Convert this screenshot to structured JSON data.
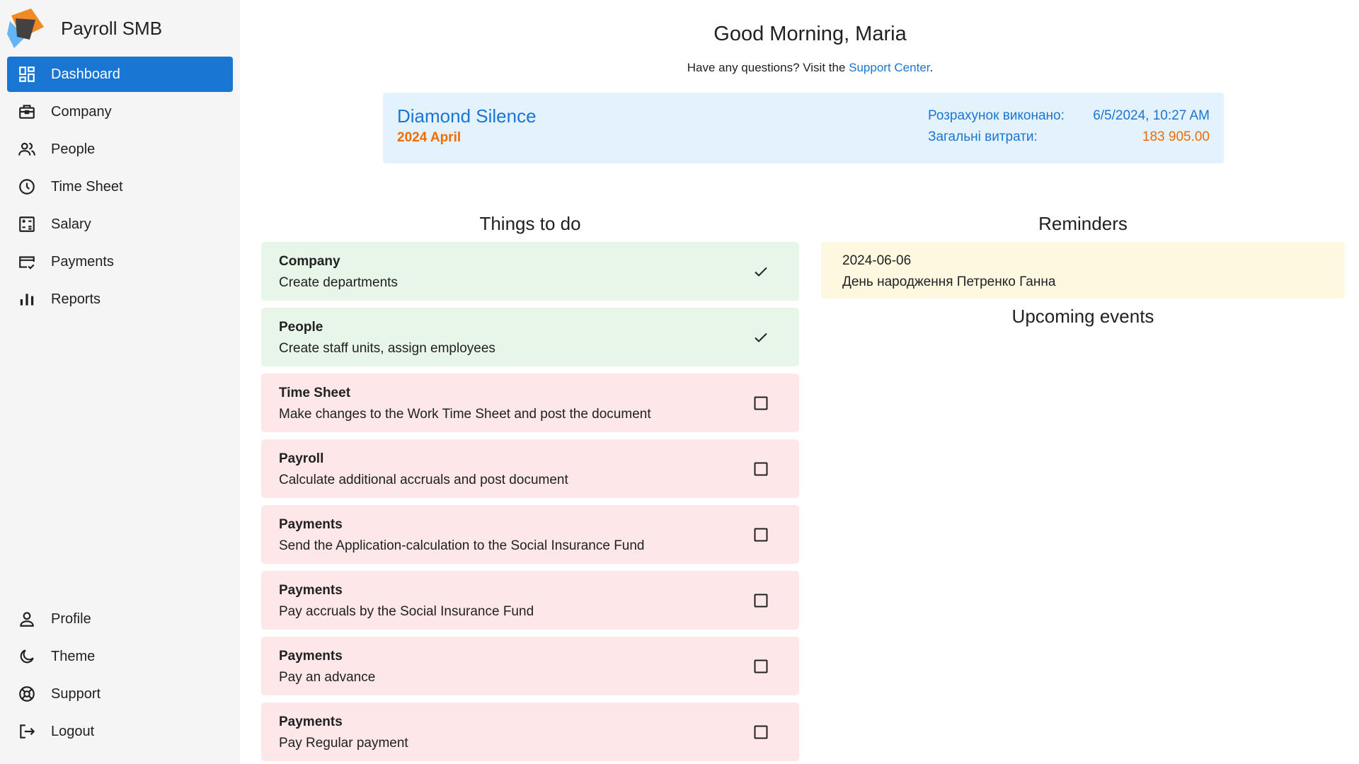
{
  "app": {
    "name": "Payroll SMB"
  },
  "sidebar": {
    "items": [
      {
        "label": "Dashboard",
        "icon": "dashboard-icon"
      },
      {
        "label": "Company",
        "icon": "briefcase-icon"
      },
      {
        "label": "People",
        "icon": "people-icon"
      },
      {
        "label": "Time Sheet",
        "icon": "clock-icon"
      },
      {
        "label": "Salary",
        "icon": "calculator-icon"
      },
      {
        "label": "Payments",
        "icon": "credit-card-icon"
      },
      {
        "label": "Reports",
        "icon": "bar-chart-icon"
      }
    ],
    "bottom_items": [
      {
        "label": "Profile",
        "icon": "user-icon"
      },
      {
        "label": "Theme",
        "icon": "moon-icon"
      },
      {
        "label": "Support",
        "icon": "lifebuoy-icon"
      },
      {
        "label": "Logout",
        "icon": "logout-icon"
      }
    ],
    "active_color": "#1976d2"
  },
  "header": {
    "greeting": "Good Morning, Maria",
    "questions_prefix": "Have any questions? Visit the ",
    "support_link": "Support Center",
    "questions_suffix": "."
  },
  "company": {
    "name": "Diamond Silence",
    "period": "2024 April",
    "calc_label": "Розрахунок виконано:",
    "calc_value": "6/5/2024, 10:27 AM",
    "total_label": "Загальні витрати:",
    "total_value": "183 905.00"
  },
  "todo": {
    "title": "Things to do",
    "items": [
      {
        "title": "Company",
        "description": "Create departments",
        "done": true
      },
      {
        "title": "People",
        "description": "Create staff units, assign employees",
        "done": true
      },
      {
        "title": "Time Sheet",
        "description": "Make changes to the Work Time Sheet and post the document",
        "done": false
      },
      {
        "title": "Payroll",
        "description": "Calculate additional accruals and post document",
        "done": false
      },
      {
        "title": "Payments",
        "description": "Send the Application-calculation to the Social Insurance Fund",
        "done": false
      },
      {
        "title": "Payments",
        "description": "Pay accruals by the Social Insurance Fund",
        "done": false
      },
      {
        "title": "Payments",
        "description": "Pay an advance",
        "done": false
      },
      {
        "title": "Payments",
        "description": "Pay Regular payment",
        "done": false
      }
    ]
  },
  "reminders": {
    "title": "Reminders",
    "items": [
      {
        "date": "2024-06-06",
        "text": "День народження Петренко Ганна"
      }
    ]
  },
  "events": {
    "title": "Upcoming events"
  },
  "colors": {
    "done_bg": "#e8f5e9",
    "pending_bg": "#fde7e9",
    "reminder_bg": "#fff8e1",
    "card_bg": "#e3f2fd",
    "accent": "#1976d2",
    "orange": "#ef6c00"
  }
}
